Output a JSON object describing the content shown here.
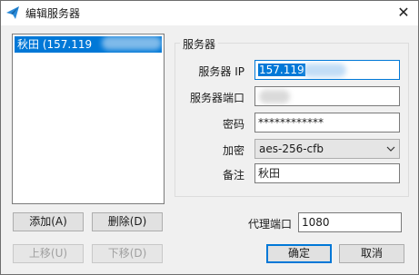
{
  "window": {
    "title": "编辑服务器",
    "close_glyph": "✕"
  },
  "server_list": {
    "items": [
      {
        "label": "秋田 (157.119"
      }
    ]
  },
  "buttons": {
    "add": "添加(A)",
    "delete": "删除(D)",
    "move_up": "上移(U)",
    "move_down": "下移(D)",
    "ok": "确定",
    "cancel": "取消"
  },
  "server_group": {
    "title": "服务器",
    "ip_label": "服务器 IP",
    "ip_value": "157.119",
    "port_label": "服务器端口",
    "port_value": "",
    "password_label": "密码",
    "password_value": "************",
    "encryption_label": "加密",
    "encryption_value": "aes-256-cfb",
    "remarks_label": "备注",
    "remarks_value": "秋田"
  },
  "proxy_port": {
    "label": "代理端口",
    "value": "1080"
  },
  "colors": {
    "accent": "#0078d7",
    "window_bg": "#f0f0f0"
  },
  "icons": {
    "app": "paper-plane-icon",
    "close": "close-icon",
    "dropdown": "chevron-down-icon"
  }
}
